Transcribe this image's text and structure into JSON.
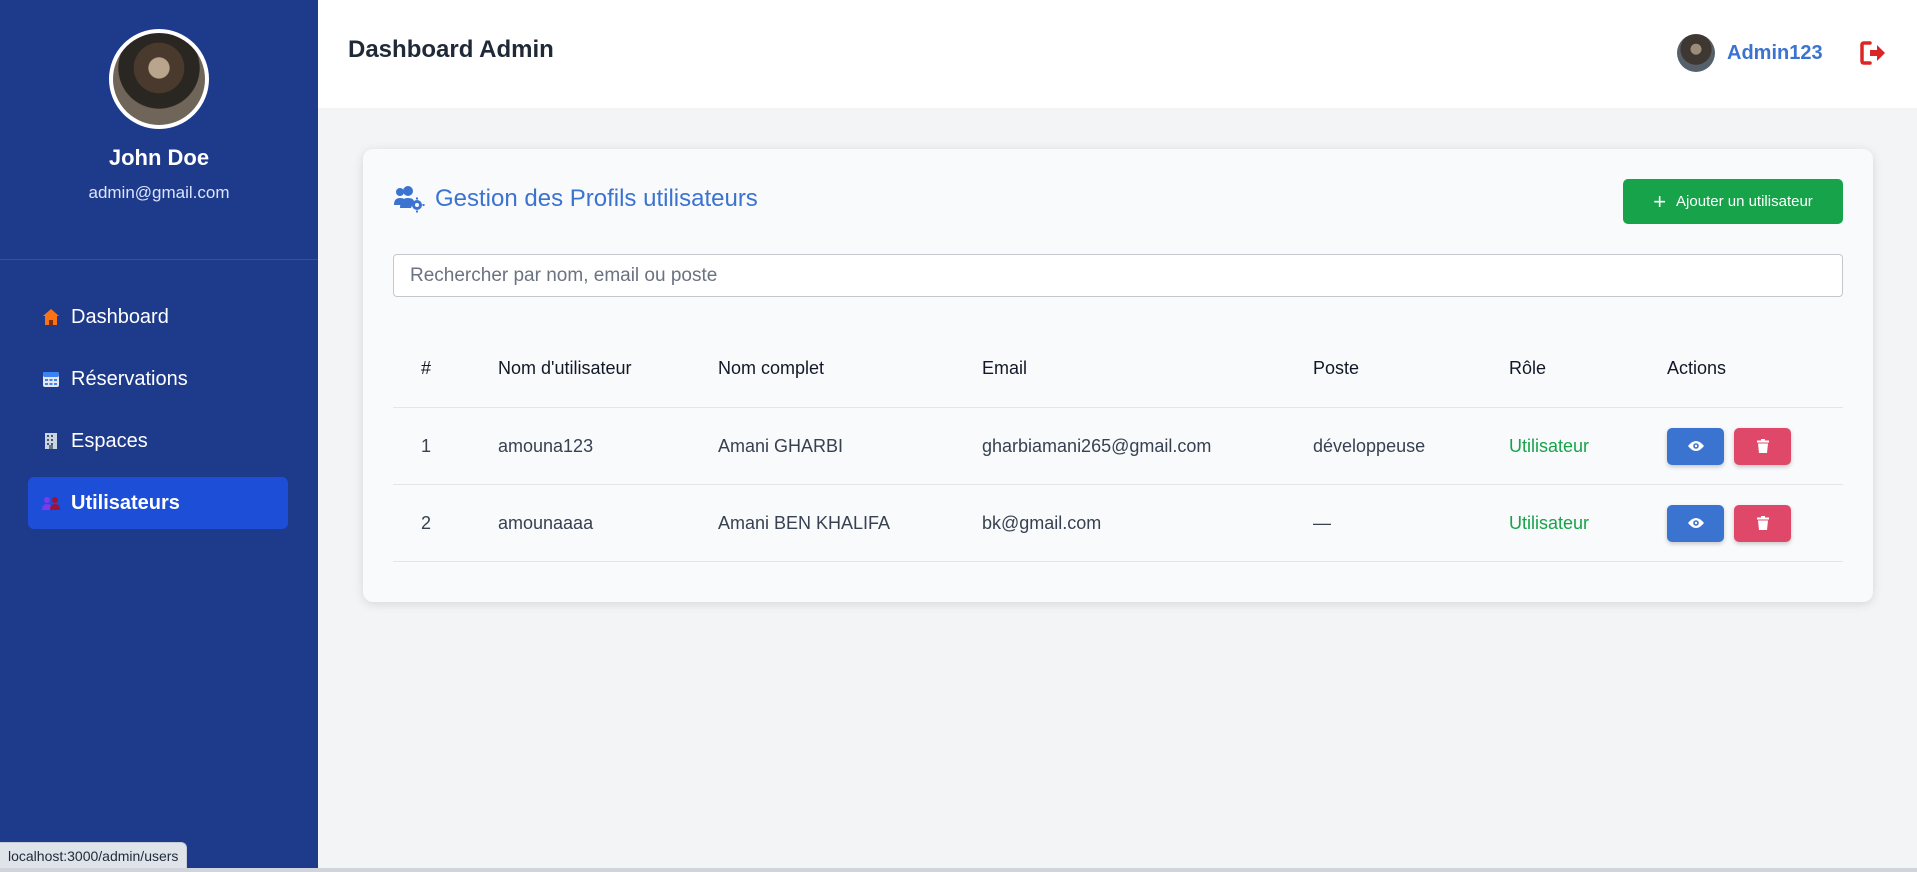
{
  "sidebar": {
    "profile": {
      "name": "John Doe",
      "email": "admin@gmail.com"
    },
    "items": [
      {
        "label": "Dashboard",
        "icon": "house-icon",
        "active": false
      },
      {
        "label": "Réservations",
        "icon": "calendar-icon",
        "active": false
      },
      {
        "label": "Espaces",
        "icon": "building-icon",
        "active": false
      },
      {
        "label": "Utilisateurs",
        "icon": "users-icon",
        "active": true
      }
    ]
  },
  "header": {
    "title": "Dashboard Admin",
    "user": "Admin123",
    "logout_icon": "logout-icon"
  },
  "main": {
    "title": "Gestion des Profils utilisateurs",
    "title_icon": "users-cog-icon",
    "add_button": "Ajouter un utilisateur",
    "search_placeholder": "Rechercher par nom, email ou poste",
    "table": {
      "columns": [
        "#",
        "Nom d'utilisateur",
        "Nom complet",
        "Email",
        "Poste",
        "Rôle",
        "Actions"
      ],
      "rows": [
        {
          "id": "1",
          "username": "amouna123",
          "fullname": "Amani GHARBI",
          "email": "gharbiamani265@gmail.com",
          "poste": "développeuse",
          "role": "Utilisateur"
        },
        {
          "id": "2",
          "username": "amounaaaa",
          "fullname": "Amani BEN KHALIFA",
          "email": "bk@gmail.com",
          "poste": "—",
          "role": "Utilisateur"
        }
      ]
    }
  },
  "status_bar": {
    "url": "localhost:3000/admin/users"
  },
  "colors": {
    "sidebar": "#1e3a8a",
    "active_item": "#1d4ed8",
    "accent": "#3b73d1",
    "success": "#16a34a",
    "danger": "#e0486a",
    "logout": "#dc2626"
  }
}
